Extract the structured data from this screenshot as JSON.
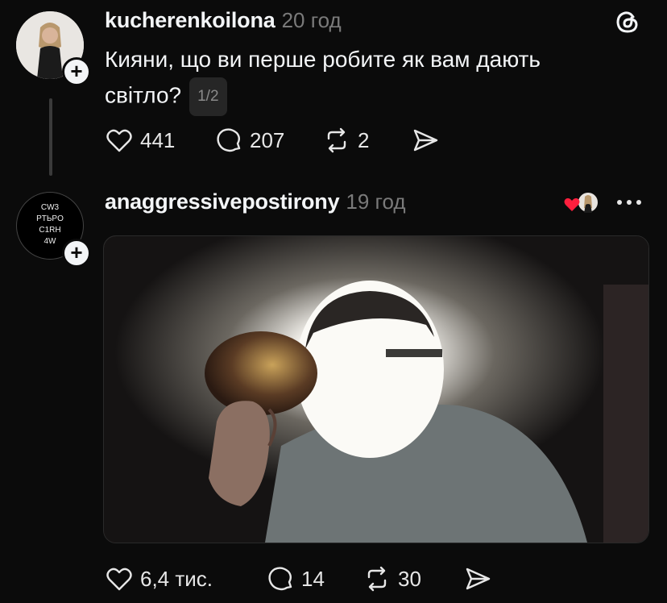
{
  "post1": {
    "username": "kucherenkoilona",
    "time": "20 год",
    "text_line1": "Кияни, що ви перше робите як вам дають",
    "text_line2": "світло?",
    "pager": "1/2",
    "likes": "441",
    "comments": "207",
    "reposts": "2"
  },
  "post2": {
    "username": "anaggressivepostirony",
    "time": "19 год",
    "avatar_text": [
      "CW3",
      "PTЬPO",
      "C1RH",
      "4W"
    ],
    "likes": "6,4 тис.",
    "comments": "14",
    "reposts": "30"
  },
  "colors": {
    "background": "#0b0b0b",
    "text": "#f3f5f7",
    "muted": "#7a7a7a",
    "heart": "#ff1f3d"
  },
  "icons": [
    "threads-logo-icon",
    "heart-icon",
    "comment-icon",
    "repost-icon",
    "share-icon",
    "more-icon",
    "plus-icon"
  ]
}
